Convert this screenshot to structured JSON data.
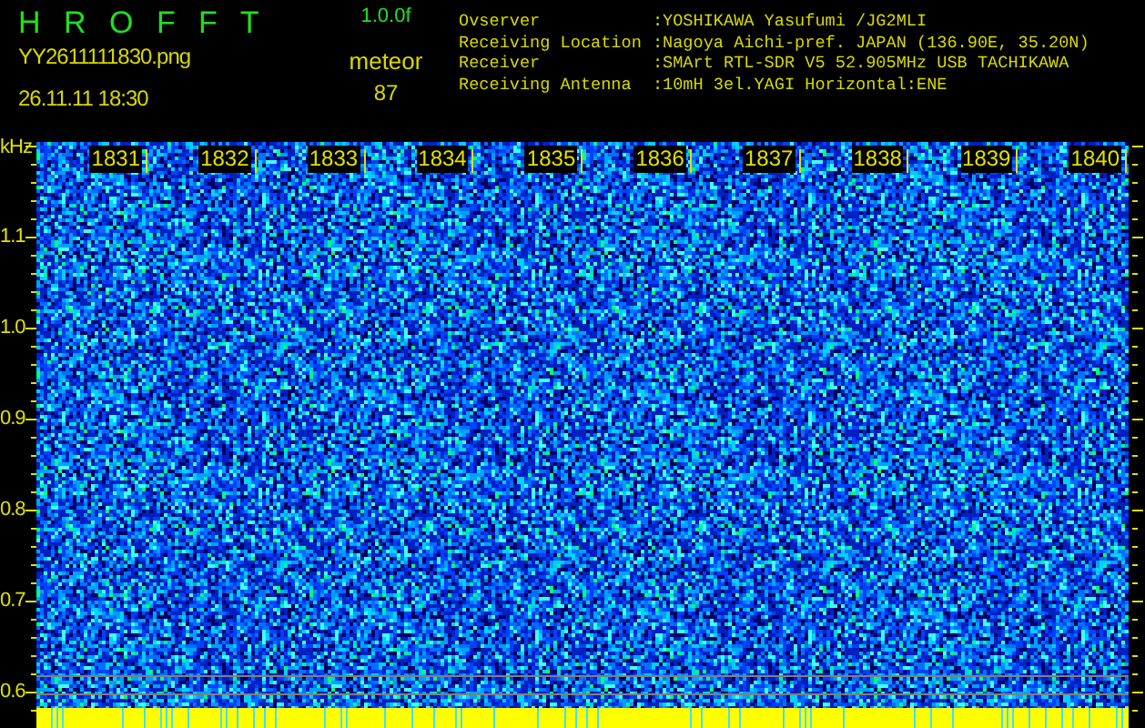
{
  "header": {
    "app_title": "H R O F F T",
    "version": "1.0.0f",
    "filename": "YY2611111830.png",
    "datetime": "26.11.11 18:30",
    "mode": "meteor",
    "count": "87"
  },
  "info": [
    {
      "label": "Ovserver",
      "value": ":YOSHIKAWA Yasufumi /JG2MLI"
    },
    {
      "label": "Receiving Location",
      "value": ":Nagoya Aichi-pref. JAPAN (136.90E, 35.20N)"
    },
    {
      "label": "Receiver",
      "value": ":SMArt RTL-SDR V5 52.905MHz USB TACHIKAWA"
    },
    {
      "label": "Receiving Antenna",
      "value": ":10mH 3el.YAGI Horizontal:ENE"
    }
  ],
  "spectrogram": {
    "unit": "kHz",
    "y_labels": [
      "1.1",
      "1.0",
      "0.9",
      "0.8",
      "0.7",
      "0.6"
    ],
    "time_marks": [
      "1831",
      "1832",
      "1833",
      "1834",
      "1835",
      "1836",
      "1837",
      "1838",
      "1839",
      "1840"
    ]
  }
}
